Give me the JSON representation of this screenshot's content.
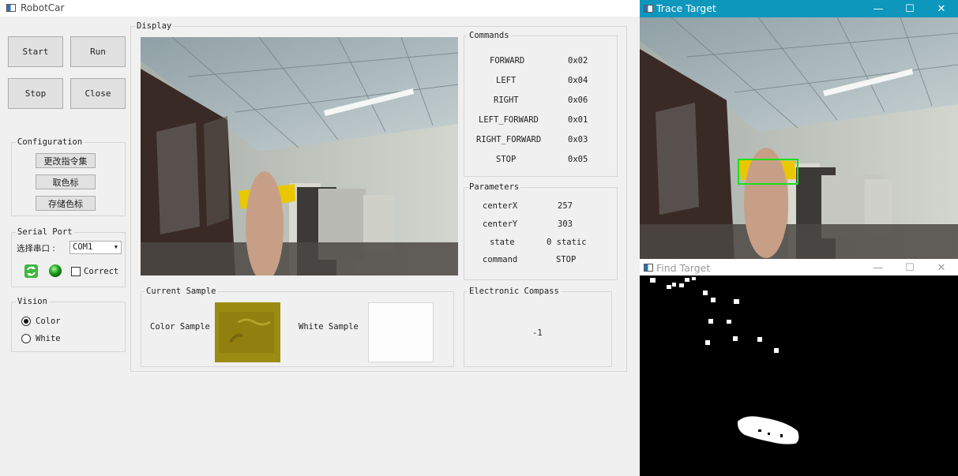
{
  "main_window": {
    "title": "RobotCar"
  },
  "buttons": {
    "start": "Start",
    "run": "Run",
    "stop": "Stop",
    "close": "Close"
  },
  "configuration": {
    "title": "Configuration",
    "change_command_set": "更改指令集",
    "pick_color": "取色标",
    "save_color": "存储色标"
  },
  "serial_port": {
    "title": "Serial Port",
    "select_label": "选择串口 :",
    "port_value": "COM1",
    "correct_label": "Correct",
    "correct_checked": false,
    "status_color": "#22aa22"
  },
  "vision": {
    "title": "Vision",
    "options": [
      "Color",
      "White"
    ],
    "selected": "Color"
  },
  "display": {
    "title": "Display"
  },
  "commands": {
    "title": "Commands",
    "rows": [
      {
        "name": "FORWARD",
        "code": "0x02"
      },
      {
        "name": "LEFT",
        "code": "0x04"
      },
      {
        "name": "RIGHT",
        "code": "0x06"
      },
      {
        "name": "LEFT_FORWARD",
        "code": "0x01"
      },
      {
        "name": "RIGHT_FORWARD",
        "code": "0x03"
      },
      {
        "name": "STOP",
        "code": "0x05"
      }
    ]
  },
  "parameters": {
    "title": "Parameters",
    "rows": [
      {
        "name": "centerX",
        "value": "257"
      },
      {
        "name": "centerY",
        "value": "303"
      },
      {
        "name": "state",
        "value": "0 static"
      },
      {
        "name": "command",
        "value": "STOP"
      }
    ]
  },
  "current_sample": {
    "title": "Current Sample",
    "color_label": "Color Sample",
    "white_label": "White Sample",
    "color_swatch": "#9a8a12",
    "white_swatch": "#fdfdfd"
  },
  "compass": {
    "title": "Electronic Compass",
    "value": "-1"
  },
  "trace_window": {
    "title": "Trace Target",
    "minimize": "—",
    "maximize": "☐",
    "close": "✕"
  },
  "find_window": {
    "title": "Find Target",
    "minimize": "—",
    "maximize": "☐",
    "close": "✕"
  }
}
